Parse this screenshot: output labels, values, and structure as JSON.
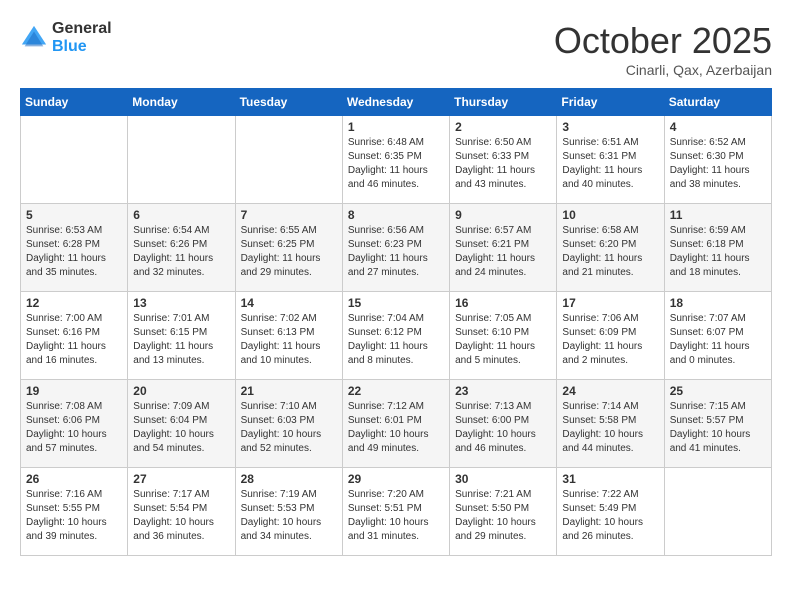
{
  "header": {
    "logo_general": "General",
    "logo_blue": "Blue",
    "month": "October 2025",
    "location": "Cinarli, Qax, Azerbaijan"
  },
  "weekdays": [
    "Sunday",
    "Monday",
    "Tuesday",
    "Wednesday",
    "Thursday",
    "Friday",
    "Saturday"
  ],
  "weeks": [
    [
      {
        "day": "",
        "info": ""
      },
      {
        "day": "",
        "info": ""
      },
      {
        "day": "",
        "info": ""
      },
      {
        "day": "1",
        "info": "Sunrise: 6:48 AM\nSunset: 6:35 PM\nDaylight: 11 hours\nand 46 minutes."
      },
      {
        "day": "2",
        "info": "Sunrise: 6:50 AM\nSunset: 6:33 PM\nDaylight: 11 hours\nand 43 minutes."
      },
      {
        "day": "3",
        "info": "Sunrise: 6:51 AM\nSunset: 6:31 PM\nDaylight: 11 hours\nand 40 minutes."
      },
      {
        "day": "4",
        "info": "Sunrise: 6:52 AM\nSunset: 6:30 PM\nDaylight: 11 hours\nand 38 minutes."
      }
    ],
    [
      {
        "day": "5",
        "info": "Sunrise: 6:53 AM\nSunset: 6:28 PM\nDaylight: 11 hours\nand 35 minutes."
      },
      {
        "day": "6",
        "info": "Sunrise: 6:54 AM\nSunset: 6:26 PM\nDaylight: 11 hours\nand 32 minutes."
      },
      {
        "day": "7",
        "info": "Sunrise: 6:55 AM\nSunset: 6:25 PM\nDaylight: 11 hours\nand 29 minutes."
      },
      {
        "day": "8",
        "info": "Sunrise: 6:56 AM\nSunset: 6:23 PM\nDaylight: 11 hours\nand 27 minutes."
      },
      {
        "day": "9",
        "info": "Sunrise: 6:57 AM\nSunset: 6:21 PM\nDaylight: 11 hours\nand 24 minutes."
      },
      {
        "day": "10",
        "info": "Sunrise: 6:58 AM\nSunset: 6:20 PM\nDaylight: 11 hours\nand 21 minutes."
      },
      {
        "day": "11",
        "info": "Sunrise: 6:59 AM\nSunset: 6:18 PM\nDaylight: 11 hours\nand 18 minutes."
      }
    ],
    [
      {
        "day": "12",
        "info": "Sunrise: 7:00 AM\nSunset: 6:16 PM\nDaylight: 11 hours\nand 16 minutes."
      },
      {
        "day": "13",
        "info": "Sunrise: 7:01 AM\nSunset: 6:15 PM\nDaylight: 11 hours\nand 13 minutes."
      },
      {
        "day": "14",
        "info": "Sunrise: 7:02 AM\nSunset: 6:13 PM\nDaylight: 11 hours\nand 10 minutes."
      },
      {
        "day": "15",
        "info": "Sunrise: 7:04 AM\nSunset: 6:12 PM\nDaylight: 11 hours\nand 8 minutes."
      },
      {
        "day": "16",
        "info": "Sunrise: 7:05 AM\nSunset: 6:10 PM\nDaylight: 11 hours\nand 5 minutes."
      },
      {
        "day": "17",
        "info": "Sunrise: 7:06 AM\nSunset: 6:09 PM\nDaylight: 11 hours\nand 2 minutes."
      },
      {
        "day": "18",
        "info": "Sunrise: 7:07 AM\nSunset: 6:07 PM\nDaylight: 11 hours\nand 0 minutes."
      }
    ],
    [
      {
        "day": "19",
        "info": "Sunrise: 7:08 AM\nSunset: 6:06 PM\nDaylight: 10 hours\nand 57 minutes."
      },
      {
        "day": "20",
        "info": "Sunrise: 7:09 AM\nSunset: 6:04 PM\nDaylight: 10 hours\nand 54 minutes."
      },
      {
        "day": "21",
        "info": "Sunrise: 7:10 AM\nSunset: 6:03 PM\nDaylight: 10 hours\nand 52 minutes."
      },
      {
        "day": "22",
        "info": "Sunrise: 7:12 AM\nSunset: 6:01 PM\nDaylight: 10 hours\nand 49 minutes."
      },
      {
        "day": "23",
        "info": "Sunrise: 7:13 AM\nSunset: 6:00 PM\nDaylight: 10 hours\nand 46 minutes."
      },
      {
        "day": "24",
        "info": "Sunrise: 7:14 AM\nSunset: 5:58 PM\nDaylight: 10 hours\nand 44 minutes."
      },
      {
        "day": "25",
        "info": "Sunrise: 7:15 AM\nSunset: 5:57 PM\nDaylight: 10 hours\nand 41 minutes."
      }
    ],
    [
      {
        "day": "26",
        "info": "Sunrise: 7:16 AM\nSunset: 5:55 PM\nDaylight: 10 hours\nand 39 minutes."
      },
      {
        "day": "27",
        "info": "Sunrise: 7:17 AM\nSunset: 5:54 PM\nDaylight: 10 hours\nand 36 minutes."
      },
      {
        "day": "28",
        "info": "Sunrise: 7:19 AM\nSunset: 5:53 PM\nDaylight: 10 hours\nand 34 minutes."
      },
      {
        "day": "29",
        "info": "Sunrise: 7:20 AM\nSunset: 5:51 PM\nDaylight: 10 hours\nand 31 minutes."
      },
      {
        "day": "30",
        "info": "Sunrise: 7:21 AM\nSunset: 5:50 PM\nDaylight: 10 hours\nand 29 minutes."
      },
      {
        "day": "31",
        "info": "Sunrise: 7:22 AM\nSunset: 5:49 PM\nDaylight: 10 hours\nand 26 minutes."
      },
      {
        "day": "",
        "info": ""
      }
    ]
  ]
}
